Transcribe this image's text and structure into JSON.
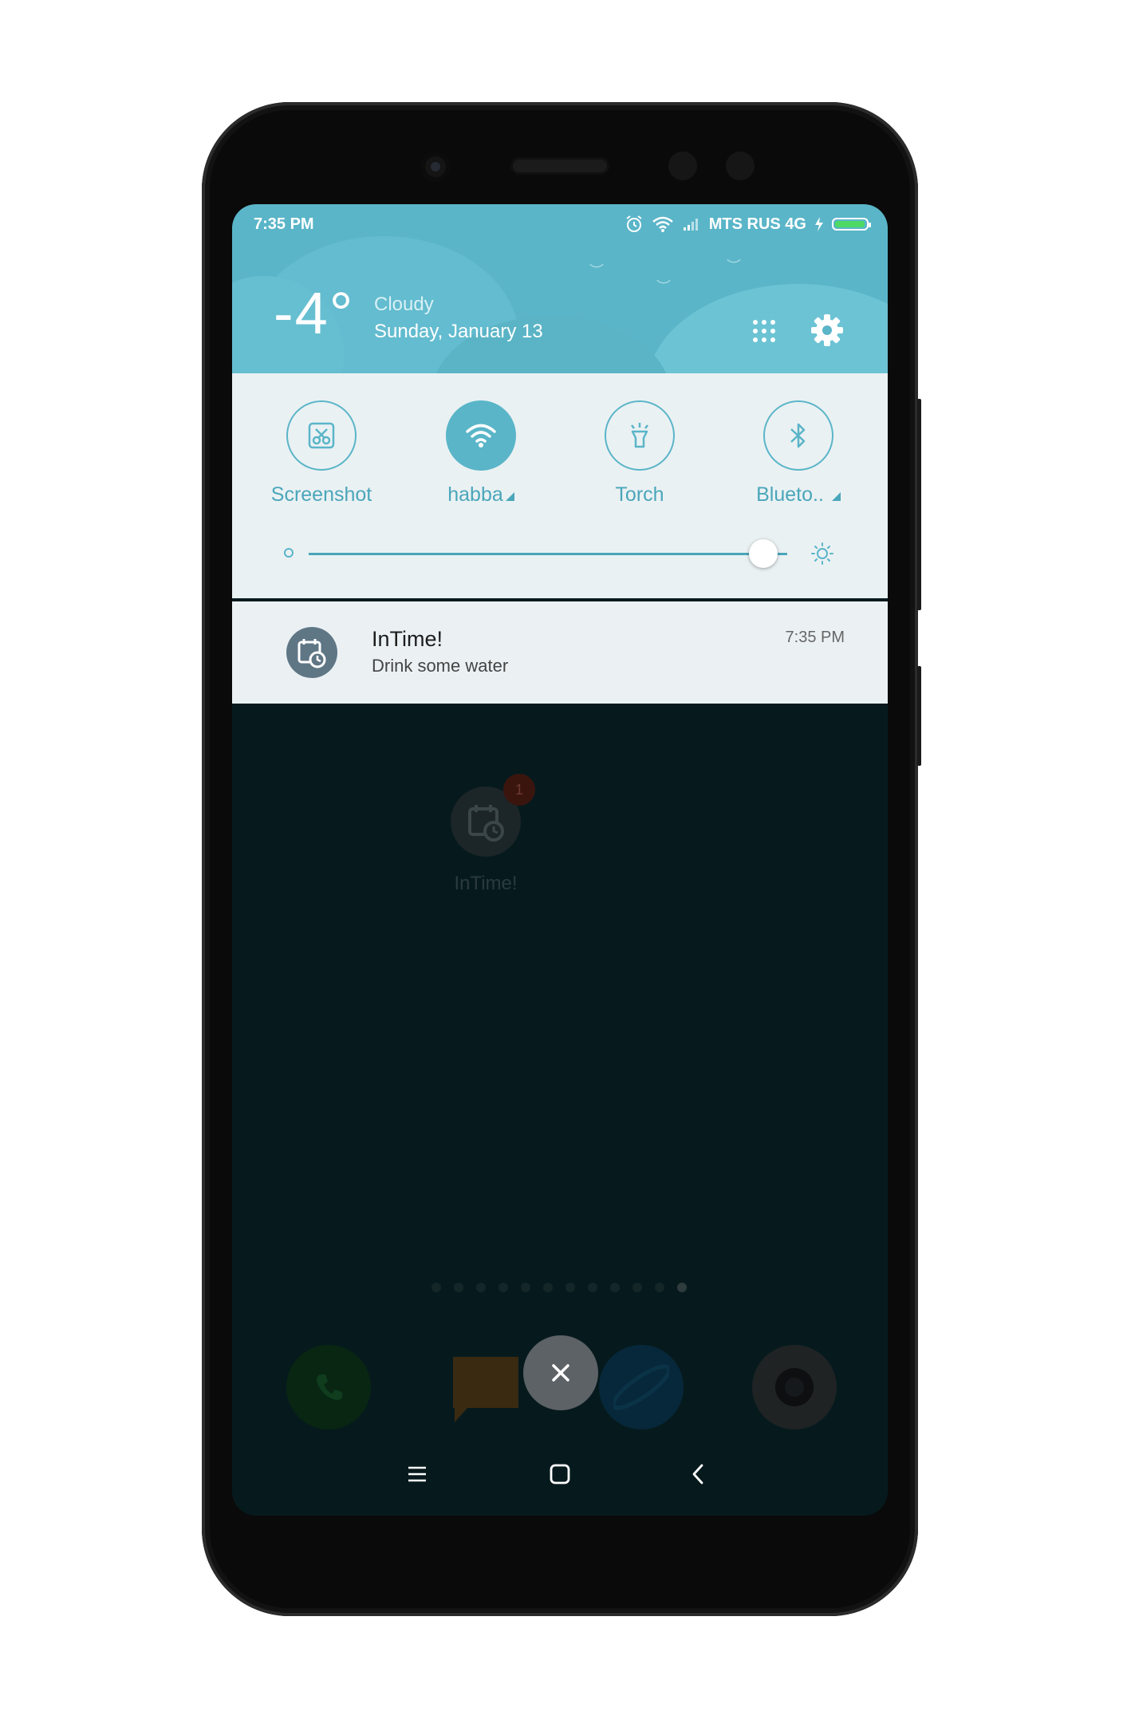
{
  "status_bar": {
    "time": "7:35 PM",
    "carrier": "MTS RUS 4G",
    "icons": [
      "alarm-icon",
      "wifi-icon",
      "signal-icon",
      "charging-icon",
      "battery-icon"
    ]
  },
  "weather": {
    "temperature": "-4°",
    "condition": "Cloudy",
    "date": "Sunday, January 13"
  },
  "quick_settings": {
    "toggles": [
      {
        "label": "Screenshot",
        "icon": "scissors-icon",
        "active": false,
        "has_arrow": false
      },
      {
        "label": "habba",
        "icon": "wifi-icon",
        "active": true,
        "has_arrow": true
      },
      {
        "label": "Torch",
        "icon": "flashlight-icon",
        "active": false,
        "has_arrow": false
      },
      {
        "label": "Blueto..",
        "icon": "bluetooth-icon",
        "active": false,
        "has_arrow": true
      }
    ],
    "brightness_level": 0.95
  },
  "notification": {
    "app": "InTime!",
    "message": "Drink some water",
    "time": "7:35 PM"
  },
  "home": {
    "app_name": "InTime!",
    "badge_count": "1",
    "page_count": 12,
    "active_page": 11,
    "dock": [
      "phone-icon",
      "messages-icon",
      "browser-icon",
      "camera-icon"
    ]
  },
  "colors": {
    "accent": "#5ab5c8",
    "header": "#5ab5c8",
    "panel": "#eaf1f3",
    "dim_background": "#061a1d"
  }
}
